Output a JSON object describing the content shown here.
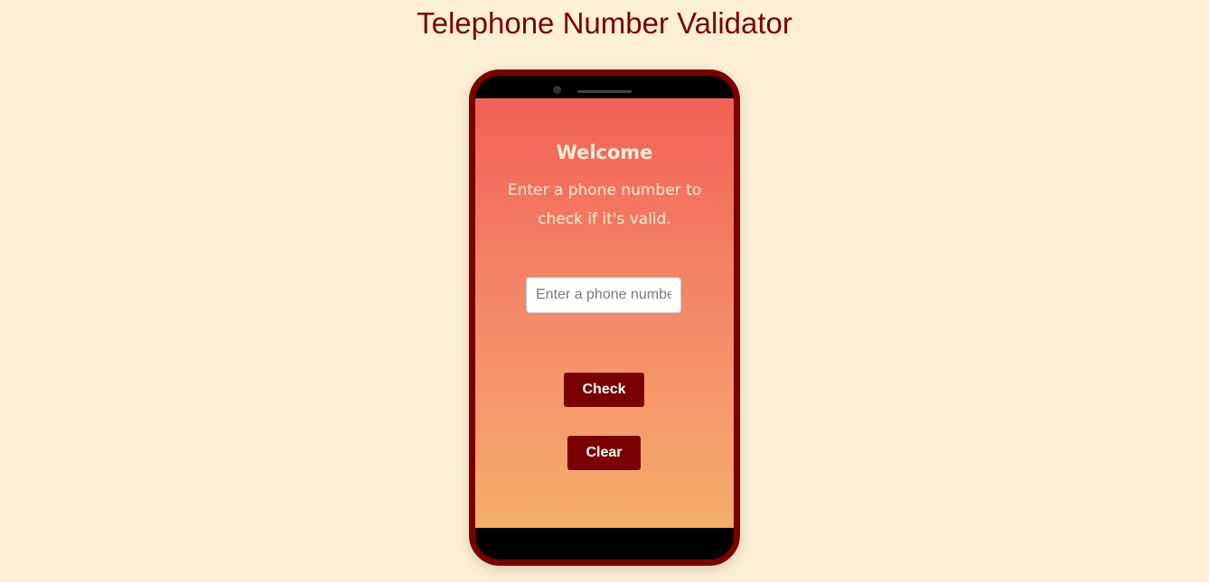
{
  "page": {
    "title": "Telephone Number Validator"
  },
  "phone_screen": {
    "heading": "Welcome",
    "instructions": "Enter a phone number to check if it's valid.",
    "input": {
      "value": "",
      "placeholder": "Enter a phone number"
    },
    "check_label": "Check",
    "clear_label": "Clear"
  },
  "colors": {
    "background": "#fdefd5",
    "accent": "#7a0000",
    "gradient_top": "#f26155",
    "gradient_bottom": "#f6ae6a"
  }
}
